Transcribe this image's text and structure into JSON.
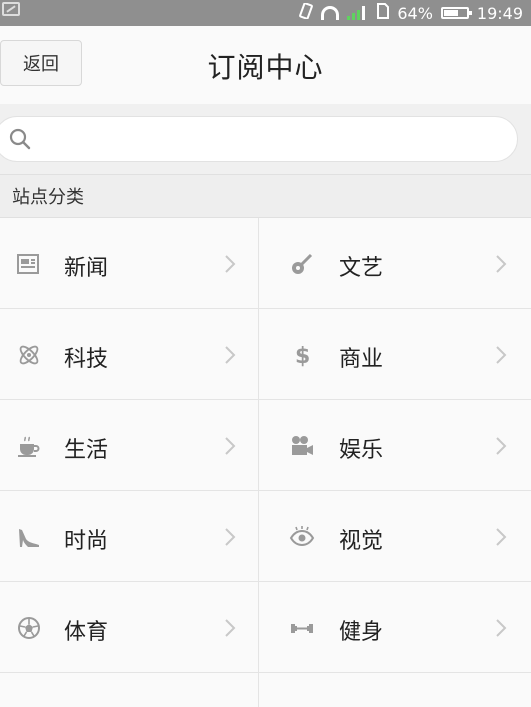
{
  "status_bar": {
    "battery": "64%",
    "time": "19:49"
  },
  "header": {
    "back_label": "返回",
    "title": "订阅中心"
  },
  "search": {
    "placeholder": ""
  },
  "section": {
    "title": "站点分类"
  },
  "categories": [
    {
      "left": {
        "label": "新闻",
        "icon": "news-icon"
      },
      "right": {
        "label": "文艺",
        "icon": "guitar-icon"
      }
    },
    {
      "left": {
        "label": "科技",
        "icon": "atom-icon"
      },
      "right": {
        "label": "商业",
        "icon": "dollar-icon"
      }
    },
    {
      "left": {
        "label": "生活",
        "icon": "coffee-icon"
      },
      "right": {
        "label": "娱乐",
        "icon": "camera-icon"
      }
    },
    {
      "left": {
        "label": "时尚",
        "icon": "high-heel-icon"
      },
      "right": {
        "label": "视觉",
        "icon": "eye-icon"
      }
    },
    {
      "left": {
        "label": "体育",
        "icon": "soccer-ball-icon"
      },
      "right": {
        "label": "健身",
        "icon": "dumbbell-icon"
      }
    }
  ],
  "colors": {
    "icon": "#9a9a9a",
    "chevron": "#c8c8c8",
    "signal": "#5fd35f"
  }
}
